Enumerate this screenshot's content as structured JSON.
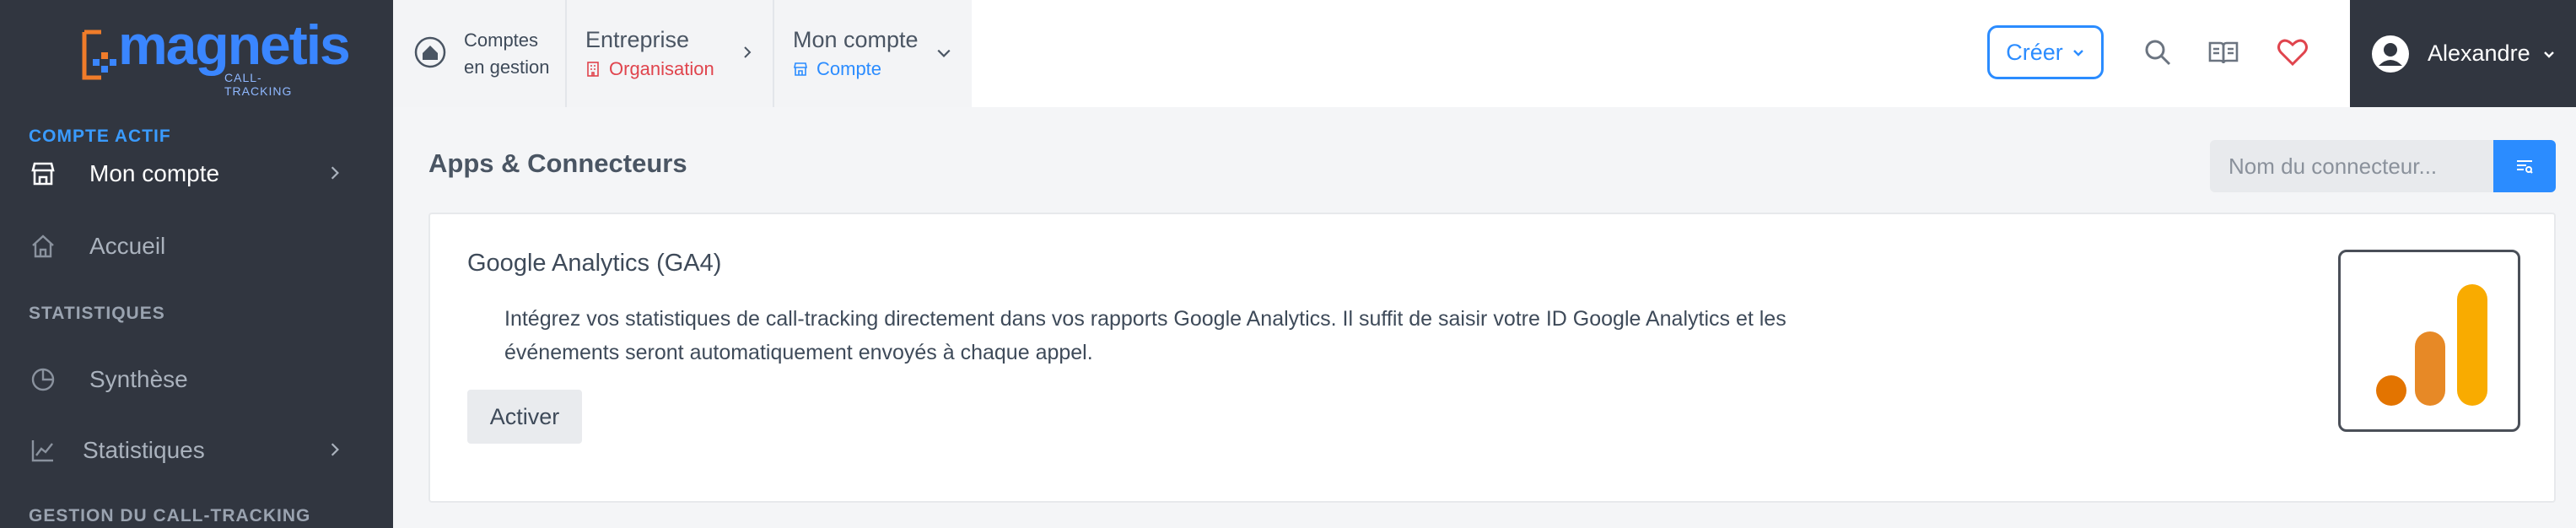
{
  "brand": {
    "word": "magnetis",
    "sub": "CALL-TRACKING",
    "accent": "#3a86ff",
    "mark_color": "#f07c2a"
  },
  "sidebar": {
    "active_section": "COMPTE ACTIF",
    "active_item": "Mon compte",
    "home": "Accueil",
    "stats_section": "STATISTIQUES",
    "synthese": "Synthèse",
    "statistiques": "Statistiques",
    "gestion_section": "GESTION DU CALL-TRACKING"
  },
  "topbar": {
    "comptes_line1": "Comptes",
    "comptes_line2": "en gestion",
    "entreprise_title": "Entreprise",
    "entreprise_sub": "Organisation",
    "entreprise_color": "#e0444d",
    "compte_title": "Mon compte",
    "compte_sub": "Compte",
    "compte_color": "#2b8cff",
    "create_label": "Créer",
    "user_name": "Alexandre",
    "icons": [
      "search-icon",
      "book-icon",
      "heart-icon"
    ]
  },
  "main": {
    "title": "Apps & Connecteurs",
    "search_placeholder": "Nom du connecteur...",
    "connector": {
      "name": "Google Analytics (GA4)",
      "description": "Intégrez vos statistiques de call-tracking directement dans vos rapports Google Analytics. Il suffit de saisir votre ID Google Analytics et les événements seront automatiquement envoyés à chaque appel.",
      "action_label": "Activer"
    }
  }
}
